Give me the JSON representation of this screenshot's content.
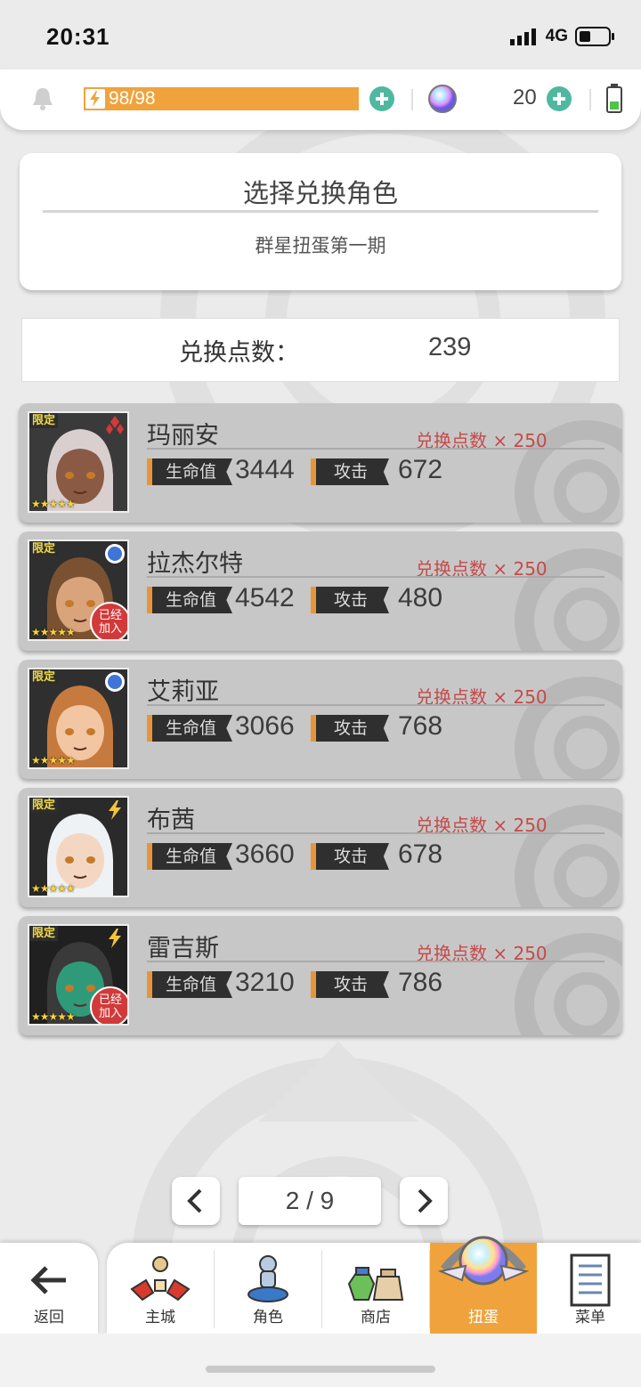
{
  "status_bar": {
    "time": "20:31",
    "network": "4G"
  },
  "top_bar": {
    "energy": "98/98",
    "gems": "20"
  },
  "header": {
    "title": "选择兑换角色",
    "subtitle": "群星扭蛋第一期"
  },
  "points": {
    "label": "兑换点数：",
    "value": "239"
  },
  "labels": {
    "hp": "生命值",
    "atk": "攻击",
    "limited": "限定",
    "joined": "已经加入",
    "stars": "★★★★★"
  },
  "characters": [
    {
      "name": "玛丽安",
      "cost": "兑换点数 × 250",
      "hp": "3444",
      "atk": "672",
      "element": "diamond-icon",
      "joined": false
    },
    {
      "name": "拉杰尔特",
      "cost": "兑换点数 × 250",
      "hp": "4542",
      "atk": "480",
      "element": "circle-icon",
      "joined": true
    },
    {
      "name": "艾莉亚",
      "cost": "兑换点数 × 250",
      "hp": "3066",
      "atk": "768",
      "element": "circle-icon",
      "joined": false
    },
    {
      "name": "布茜",
      "cost": "兑换点数 × 250",
      "hp": "3660",
      "atk": "678",
      "element": "lightning-icon",
      "joined": false
    },
    {
      "name": "雷吉斯",
      "cost": "兑换点数 × 250",
      "hp": "3210",
      "atk": "786",
      "element": "lightning-icon",
      "joined": true
    }
  ],
  "pager": {
    "text": "2 / 9"
  },
  "nav": {
    "back": "返回",
    "items": [
      {
        "label": "主城",
        "icon": "castle-icon"
      },
      {
        "label": "角色",
        "icon": "character-icon"
      },
      {
        "label": "商店",
        "icon": "shop-icon"
      },
      {
        "label": "扭蛋",
        "icon": "gacha-icon",
        "active": true
      },
      {
        "label": "菜单",
        "icon": "menu-icon"
      }
    ]
  },
  "colors": {
    "accent": "#f0a33c",
    "teal": "#4fb8a0",
    "cost_red": "#c64a4a",
    "card_bg": "#c7c7c7"
  }
}
